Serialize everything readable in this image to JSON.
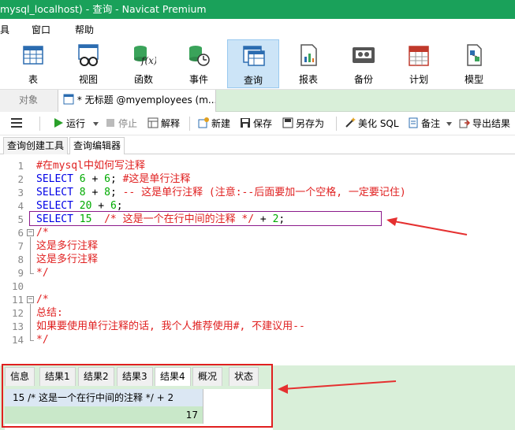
{
  "window": {
    "title": "mysql_localhost) - 查询 - Navicat Premium",
    "titlebar_color": "#1aa15a"
  },
  "menu": {
    "items": [
      {
        "label": "具"
      },
      {
        "label": "窗口"
      },
      {
        "label": "帮助"
      }
    ]
  },
  "ribbon": {
    "buttons": [
      {
        "label": "表",
        "icon": "table-icon"
      },
      {
        "label": "视图",
        "icon": "view-icon"
      },
      {
        "label": "函数",
        "icon": "function-icon",
        "icon_text": "f(x)"
      },
      {
        "label": "事件",
        "icon": "event-icon"
      },
      {
        "label": "查询",
        "icon": "query-icon",
        "active": true
      },
      {
        "label": "报表",
        "icon": "report-icon"
      },
      {
        "label": "备份",
        "icon": "backup-icon"
      },
      {
        "label": "计划",
        "icon": "schedule-icon"
      },
      {
        "label": "模型",
        "icon": "model-icon"
      }
    ]
  },
  "tabs": {
    "object_tab": "对象",
    "query_tab": "* 无标题 @myemployees (m..."
  },
  "toolbar": {
    "run": "运行",
    "stop": "停止",
    "explain": "解释",
    "new": "新建",
    "save": "保存",
    "save_as": "另存为",
    "beautify": "美化 SQL",
    "comment": "备注",
    "export": "导出结果"
  },
  "subtabs": {
    "builder": "查询创建工具",
    "editor": "查询编辑器"
  },
  "editor": {
    "lines": [
      {
        "n": "1",
        "parts": [
          {
            "t": "#在mysql中如何写注释",
            "c": "cm"
          }
        ]
      },
      {
        "n": "2",
        "parts": [
          {
            "t": "SELECT",
            "c": "kw"
          },
          {
            "t": " ",
            "c": "pl"
          },
          {
            "t": "6",
            "c": "num"
          },
          {
            "t": " + ",
            "c": "pl"
          },
          {
            "t": "6",
            "c": "num"
          },
          {
            "t": "; ",
            "c": "pl"
          },
          {
            "t": "#这是单行注释",
            "c": "cm"
          }
        ]
      },
      {
        "n": "3",
        "parts": [
          {
            "t": "SELECT",
            "c": "kw"
          },
          {
            "t": " ",
            "c": "pl"
          },
          {
            "t": "8",
            "c": "num"
          },
          {
            "t": " + ",
            "c": "pl"
          },
          {
            "t": "8",
            "c": "num"
          },
          {
            "t": "; ",
            "c": "pl"
          },
          {
            "t": "-- 这是单行注释 (注意:--后面要加一个空格, 一定要记住)",
            "c": "cm"
          }
        ]
      },
      {
        "n": "4",
        "parts": [
          {
            "t": "SELECT",
            "c": "kw"
          },
          {
            "t": " ",
            "c": "pl"
          },
          {
            "t": "20",
            "c": "num"
          },
          {
            "t": " + ",
            "c": "pl"
          },
          {
            "t": "6",
            "c": "num"
          },
          {
            "t": ";",
            "c": "pl"
          }
        ]
      },
      {
        "n": "5",
        "parts": [
          {
            "t": "SELECT",
            "c": "kw"
          },
          {
            "t": " ",
            "c": "pl"
          },
          {
            "t": "15",
            "c": "num"
          },
          {
            "t": "  ",
            "c": "pl"
          },
          {
            "t": "/* 这是一个在行中间的注释 */",
            "c": "cm"
          },
          {
            "t": " + ",
            "c": "pl"
          },
          {
            "t": "2",
            "c": "num"
          },
          {
            "t": ";",
            "c": "pl"
          }
        ]
      },
      {
        "n": "6",
        "parts": [
          {
            "t": "/*",
            "c": "cm"
          }
        ],
        "fold": "start"
      },
      {
        "n": "7",
        "parts": [
          {
            "t": "这是多行注释",
            "c": "cm"
          }
        ]
      },
      {
        "n": "8",
        "parts": [
          {
            "t": "这是多行注释",
            "c": "cm"
          }
        ]
      },
      {
        "n": "9",
        "parts": [
          {
            "t": "*/",
            "c": "cm"
          }
        ],
        "fold": "end"
      },
      {
        "n": "10",
        "parts": []
      },
      {
        "n": "11",
        "parts": [
          {
            "t": "/*",
            "c": "cm"
          }
        ],
        "fold": "start"
      },
      {
        "n": "12",
        "parts": [
          {
            "t": "总结:",
            "c": "cm"
          }
        ]
      },
      {
        "n": "13",
        "parts": [
          {
            "t": "如果要使用单行注释的话, 我个人推荐使用#, 不建议用--",
            "c": "cm"
          }
        ]
      },
      {
        "n": "14",
        "parts": [
          {
            "t": "*/",
            "c": "cm"
          }
        ],
        "fold": "end"
      }
    ]
  },
  "results": {
    "tabs": [
      "信息",
      "结果1",
      "结果2",
      "结果3",
      "结果4",
      "概况",
      "状态"
    ],
    "active_tab": "结果4",
    "column_header": "15  /* 这是一个在行中间的注释 */ + 2",
    "value": "17"
  }
}
